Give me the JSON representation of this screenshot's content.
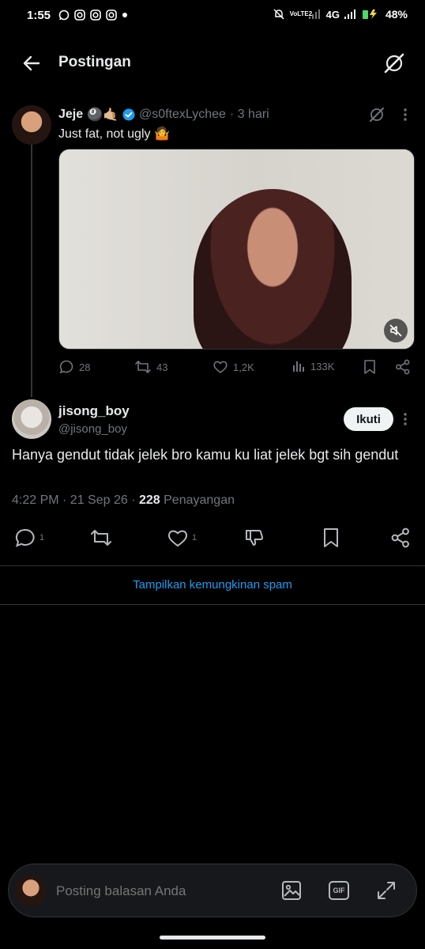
{
  "status_bar": {
    "time": "1:55",
    "network": "4G",
    "volte": "VoLTE2",
    "battery": "48%"
  },
  "header": {
    "title": "Postingan"
  },
  "original_post": {
    "name": "Jeje",
    "name_emoji": "🎱🤙🏼",
    "handle": "@s0ftexLychee",
    "time": "· 3 hari",
    "text": "Just fat, not ugly 🤷",
    "stats": {
      "replies": "28",
      "reposts": "43",
      "likes": "1,2K",
      "views": "133K"
    }
  },
  "reply_post": {
    "name": "jisong_boy",
    "handle": "@jisong_boy",
    "follow_label": "Ikuti",
    "text": "Hanya gendut tidak jelek bro kamu ku liat jelek bgt sih gendut",
    "timestamp": "4:22 PM · 21 Sep 26 · ",
    "view_count": "228",
    "view_label": " Penayangan",
    "stats": {
      "replies": "1",
      "likes": "1"
    }
  },
  "spam_link": "Tampilkan kemungkinan spam",
  "composer": {
    "placeholder": "Posting balasan Anda",
    "gif_label": "GIF"
  },
  "colors": {
    "background": "#000000",
    "accent": "#1d9bf0",
    "muted": "#71767b",
    "text": "#e7e9ea"
  }
}
